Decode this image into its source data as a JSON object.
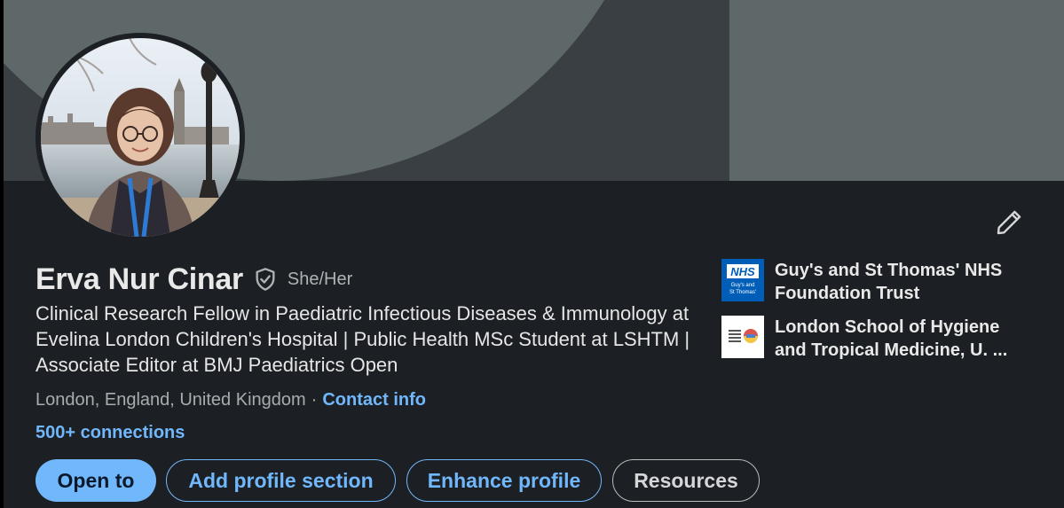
{
  "profile": {
    "name": "Erva Nur Cinar",
    "pronouns": "She/Her",
    "headline": "Clinical Research Fellow in Paediatric Infectious Diseases & Immunology at Evelina London Children's Hospital | Public Health MSc Student at LSHTM | Associate Editor at BMJ Paediatrics Open",
    "location": "London, England, United Kingdom",
    "separator": "·",
    "contact_info": "Contact info",
    "connections": "500+ connections"
  },
  "actions": {
    "open_to": "Open to",
    "add_profile_section": "Add profile section",
    "enhance_profile": "Enhance profile",
    "resources": "Resources"
  },
  "organizations": [
    {
      "name": "Guy's and St Thomas' NHS Foundation Trust",
      "logo_text": "NHS",
      "logo_subtext_1": "Guy's and",
      "logo_subtext_2": "St Thomas'"
    },
    {
      "name": "London School of Hygiene and Tropical Medicine, U. ..."
    }
  ],
  "icons": {
    "verify": "shield-check-icon",
    "edit": "pencil-icon"
  },
  "colors": {
    "card_bg": "#1c1f23",
    "banner_bg": "#3a3f43",
    "banner_accent": "#5f6868",
    "link": "#71b7fb",
    "nhs_blue": "#005eb8"
  }
}
